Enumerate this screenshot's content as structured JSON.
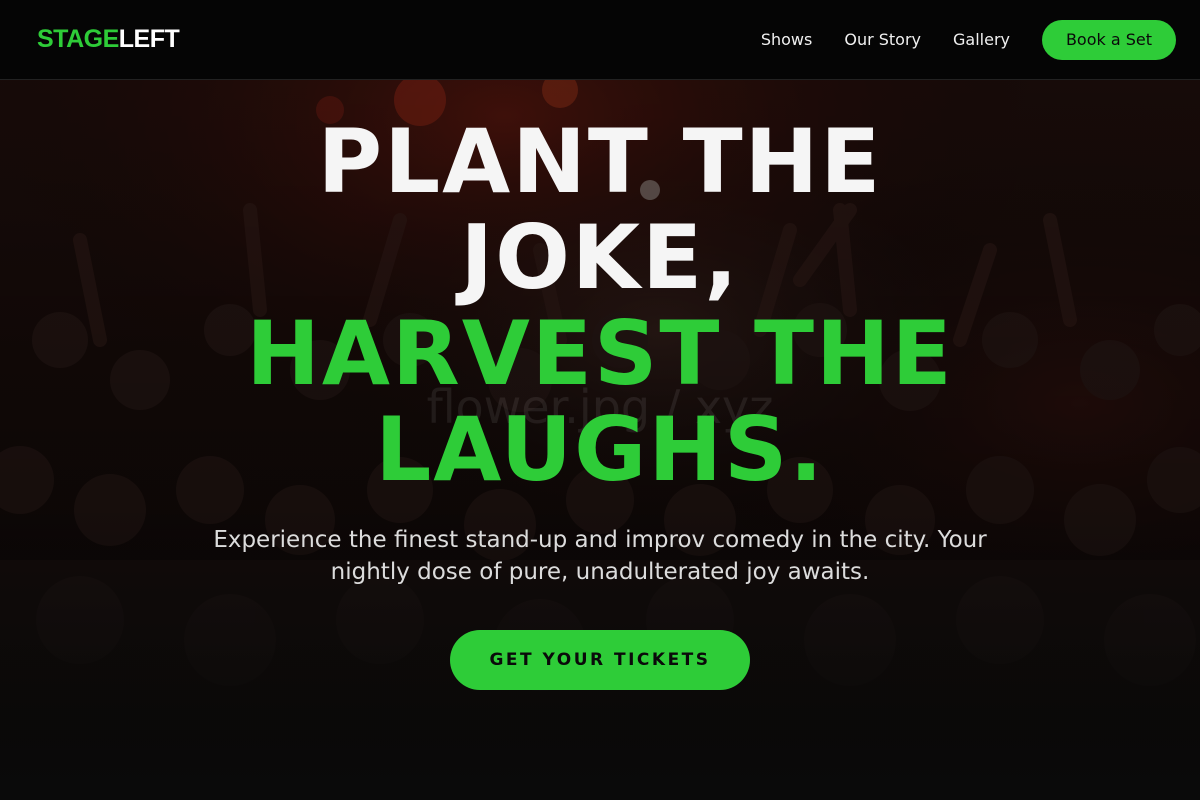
{
  "brand": {
    "part1": "STAGE",
    "part2": "LEFT"
  },
  "nav": {
    "items": [
      {
        "label": "Shows"
      },
      {
        "label": "Our Story"
      },
      {
        "label": "Gallery"
      }
    ],
    "cta": "Book a Set"
  },
  "hero": {
    "headline_lines": [
      {
        "text": "PLANT THE",
        "tone": "white"
      },
      {
        "text": "JOKE,",
        "tone": "white"
      },
      {
        "text": "HARVEST THE",
        "tone": "green"
      },
      {
        "text": "LAUGHS.",
        "tone": "green"
      }
    ],
    "subtitle": "Experience the finest stand-up and improv comedy in the city. Your nightly dose of pure, unadulterated joy awaits.",
    "cta": "GET YOUR TICKETS",
    "watermark": "flower.jpg / xyz"
  },
  "colors": {
    "accent": "#2ecc38",
    "background": "#0a0a0a",
    "header_bg": "#050505",
    "text": "#f3f3f3"
  }
}
